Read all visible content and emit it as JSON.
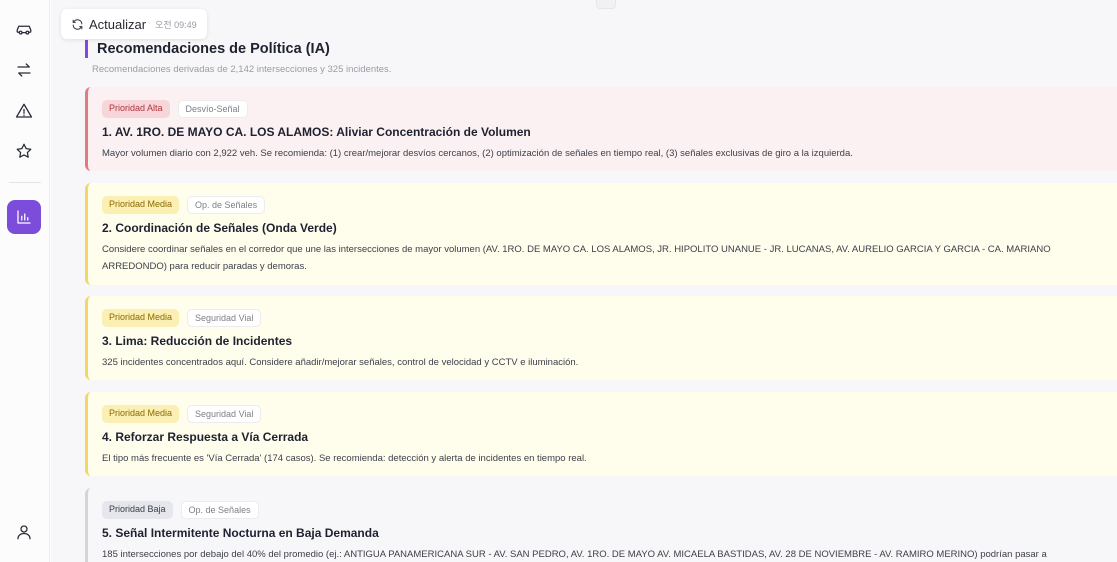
{
  "refresh": {
    "label": "Actualizar",
    "time": "오전 09:49"
  },
  "section": {
    "title": "Recomendaciones de Política (IA)",
    "subtitle": "Recomendaciones derivadas de 2,142 intersecciones y 325 incidentes."
  },
  "cards": [
    {
      "priority": "Prioridad Alta",
      "category": "Desvío-Señal",
      "title": "1. AV. 1RO. DE MAYO CA. LOS ALAMOS: Aliviar Concentración de Volumen",
      "description": "Mayor volumen diario con 2,922 veh. Se recomienda: (1) crear/mejorar desvíos cercanos, (2) optimización de señales en tiempo real, (3) señales exclusivas de giro a la izquierda."
    },
    {
      "priority": "Prioridad Media",
      "category": "Op. de Señales",
      "title": "2. Coordinación de Señales (Onda Verde)",
      "description": "Considere coordinar señales en el corredor que une las intersecciones de mayor volumen (AV. 1RO. DE MAYO CA. LOS ALAMOS, JR. HIPOLITO UNANUE - JR. LUCANAS, AV. AURELIO GARCIA Y GARCIA - CA. MARIANO ARREDONDO) para reducir paradas y demoras."
    },
    {
      "priority": "Prioridad Media",
      "category": "Seguridad Vial",
      "title": "3. Lima: Reducción de Incidentes",
      "description": "325 incidentes concentrados aquí. Considere añadir/mejorar señales, control de velocidad y CCTV e iluminación."
    },
    {
      "priority": "Prioridad Media",
      "category": "Seguridad Vial",
      "title": "4. Reforzar Respuesta a Vía Cerrada",
      "description": "El tipo más frecuente es 'Vía Cerrada' (174 casos). Se recomienda: detección y alerta de incidentes en tiempo real."
    },
    {
      "priority": "Prioridad Baja",
      "category": "Op. de Señales",
      "title": "5. Señal Intermitente Nocturna en Baja Demanda",
      "description": "185 intersecciones por debajo del 40% del promedio (ej.: ANTIGUA PANAMERICANA SUR - AV. SAN PEDRO, AV. 1RO. DE MAYO AV. MICAELA BASTIDAS, AV. 28 DE NOVIEMBRE - AV. RAMIRO MERINO) podrían pasar a"
    }
  ],
  "nav": {
    "items": [
      "car-icon",
      "swap-arrows-icon",
      "warning-icon",
      "star-icon",
      "bar-chart-icon"
    ],
    "active": "bar-chart-icon",
    "bottom": "user-icon"
  },
  "colors": {
    "accent": "#7c4ddb",
    "high": "#e07a83",
    "medium": "#f2d66a",
    "low": "#d3d4da"
  }
}
